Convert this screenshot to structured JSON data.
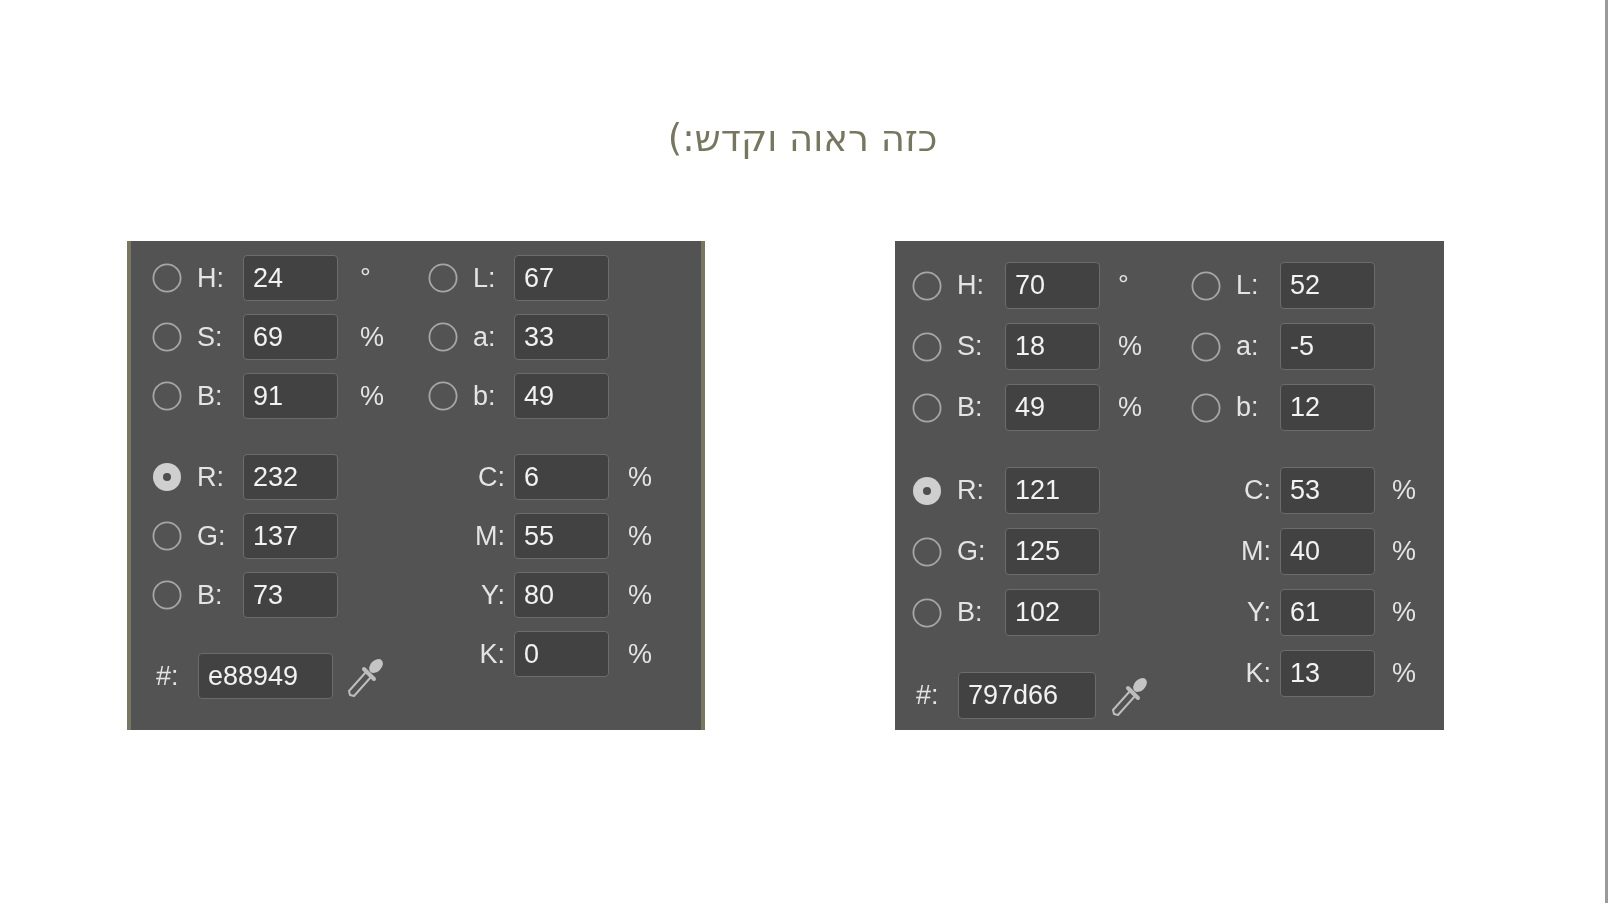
{
  "title": "כזה ראוה וקדש:)",
  "panels": [
    {
      "bordered": true,
      "hsb": [
        {
          "label": "H:",
          "value": "24",
          "unit": "°",
          "selected": false
        },
        {
          "label": "S:",
          "value": "69",
          "unit": "%",
          "selected": false
        },
        {
          "label": "B:",
          "value": "91",
          "unit": "%",
          "selected": false
        }
      ],
      "rgb": [
        {
          "label": "R:",
          "value": "232",
          "selected": true
        },
        {
          "label": "G:",
          "value": "137",
          "selected": false
        },
        {
          "label": "B:",
          "value": "73",
          "selected": false
        }
      ],
      "hex": {
        "label": "#:",
        "value": "e88949"
      },
      "lab": [
        {
          "label": "L:",
          "value": "67",
          "selected": false
        },
        {
          "label": "a:",
          "value": "33",
          "selected": false
        },
        {
          "label": "b:",
          "value": "49",
          "selected": false
        }
      ],
      "cmyk": [
        {
          "label": "C:",
          "value": "6",
          "unit": "%"
        },
        {
          "label": "M:",
          "value": "55",
          "unit": "%"
        },
        {
          "label": "Y:",
          "value": "80",
          "unit": "%"
        },
        {
          "label": "K:",
          "value": "0",
          "unit": "%"
        }
      ]
    },
    {
      "bordered": false,
      "hsb": [
        {
          "label": "H:",
          "value": "70",
          "unit": "°",
          "selected": false
        },
        {
          "label": "S:",
          "value": "18",
          "unit": "%",
          "selected": false
        },
        {
          "label": "B:",
          "value": "49",
          "unit": "%",
          "selected": false
        }
      ],
      "rgb": [
        {
          "label": "R:",
          "value": "121",
          "selected": true
        },
        {
          "label": "G:",
          "value": "125",
          "selected": false
        },
        {
          "label": "B:",
          "value": "102",
          "selected": false
        }
      ],
      "hex": {
        "label": "#:",
        "value": "797d66"
      },
      "lab": [
        {
          "label": "L:",
          "value": "52",
          "selected": false
        },
        {
          "label": "a:",
          "value": "-5",
          "selected": false
        },
        {
          "label": "b:",
          "value": "12",
          "selected": false
        }
      ],
      "cmyk": [
        {
          "label": "C:",
          "value": "53",
          "unit": "%"
        },
        {
          "label": "M:",
          "value": "40",
          "unit": "%"
        },
        {
          "label": "Y:",
          "value": "61",
          "unit": "%"
        },
        {
          "label": "K:",
          "value": "13",
          "unit": "%"
        }
      ]
    }
  ]
}
